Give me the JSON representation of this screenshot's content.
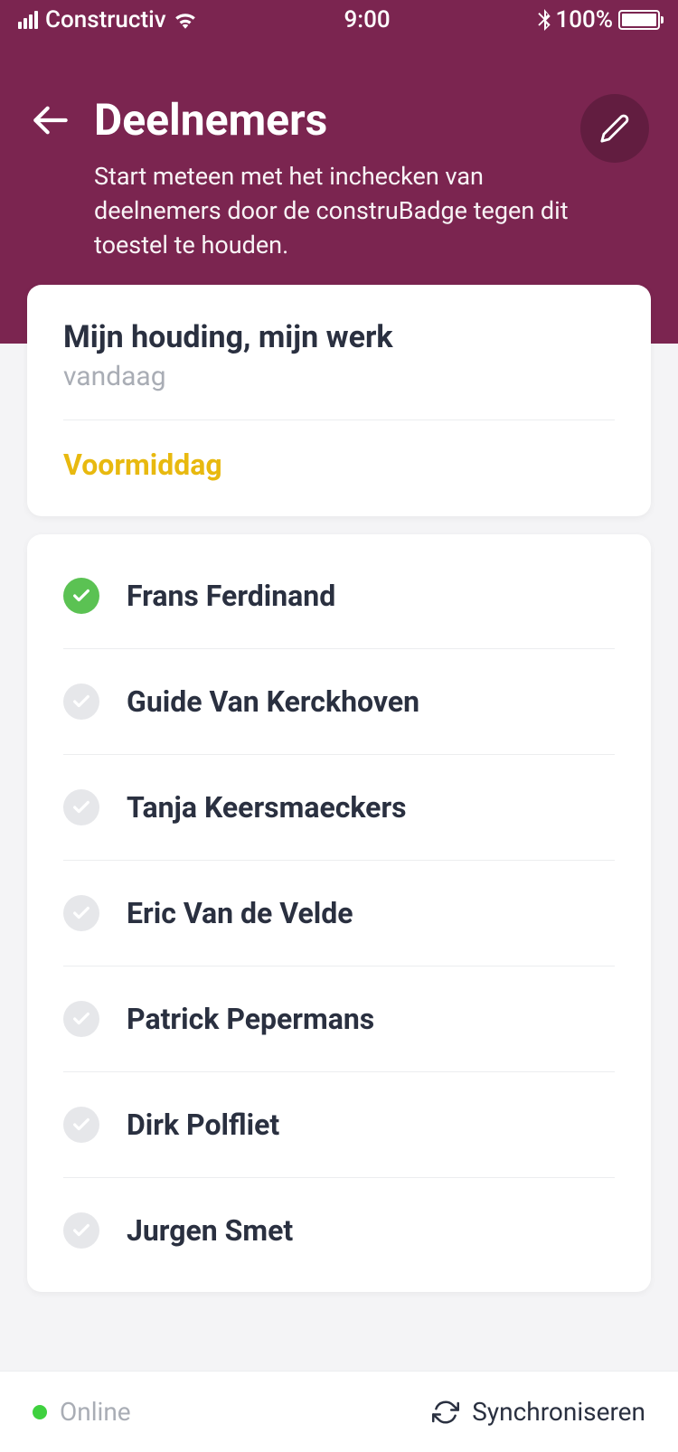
{
  "statusBar": {
    "carrier": "Constructiv",
    "time": "9:00",
    "battery": "100%"
  },
  "header": {
    "title": "Deelnemers",
    "subtitle": "Start meteen met het inchecken van deelnemers door de construBadge tegen dit toestel te houden."
  },
  "session": {
    "title": "Mijn houding, mijn werk",
    "date": "vandaag",
    "period": "Voormiddag"
  },
  "participants": [
    {
      "name": "Frans Ferdinand",
      "checked": true
    },
    {
      "name": "Guide Van Kerckhoven",
      "checked": false
    },
    {
      "name": "Tanja Keersmaeckers",
      "checked": false
    },
    {
      "name": "Eric Van de Velde",
      "checked": false
    },
    {
      "name": "Patrick Pepermans",
      "checked": false
    },
    {
      "name": "Dirk Polfliet",
      "checked": false
    },
    {
      "name": "Jurgen Smet",
      "checked": false
    }
  ],
  "footer": {
    "status": "Online",
    "sync": "Synchroniseren"
  }
}
